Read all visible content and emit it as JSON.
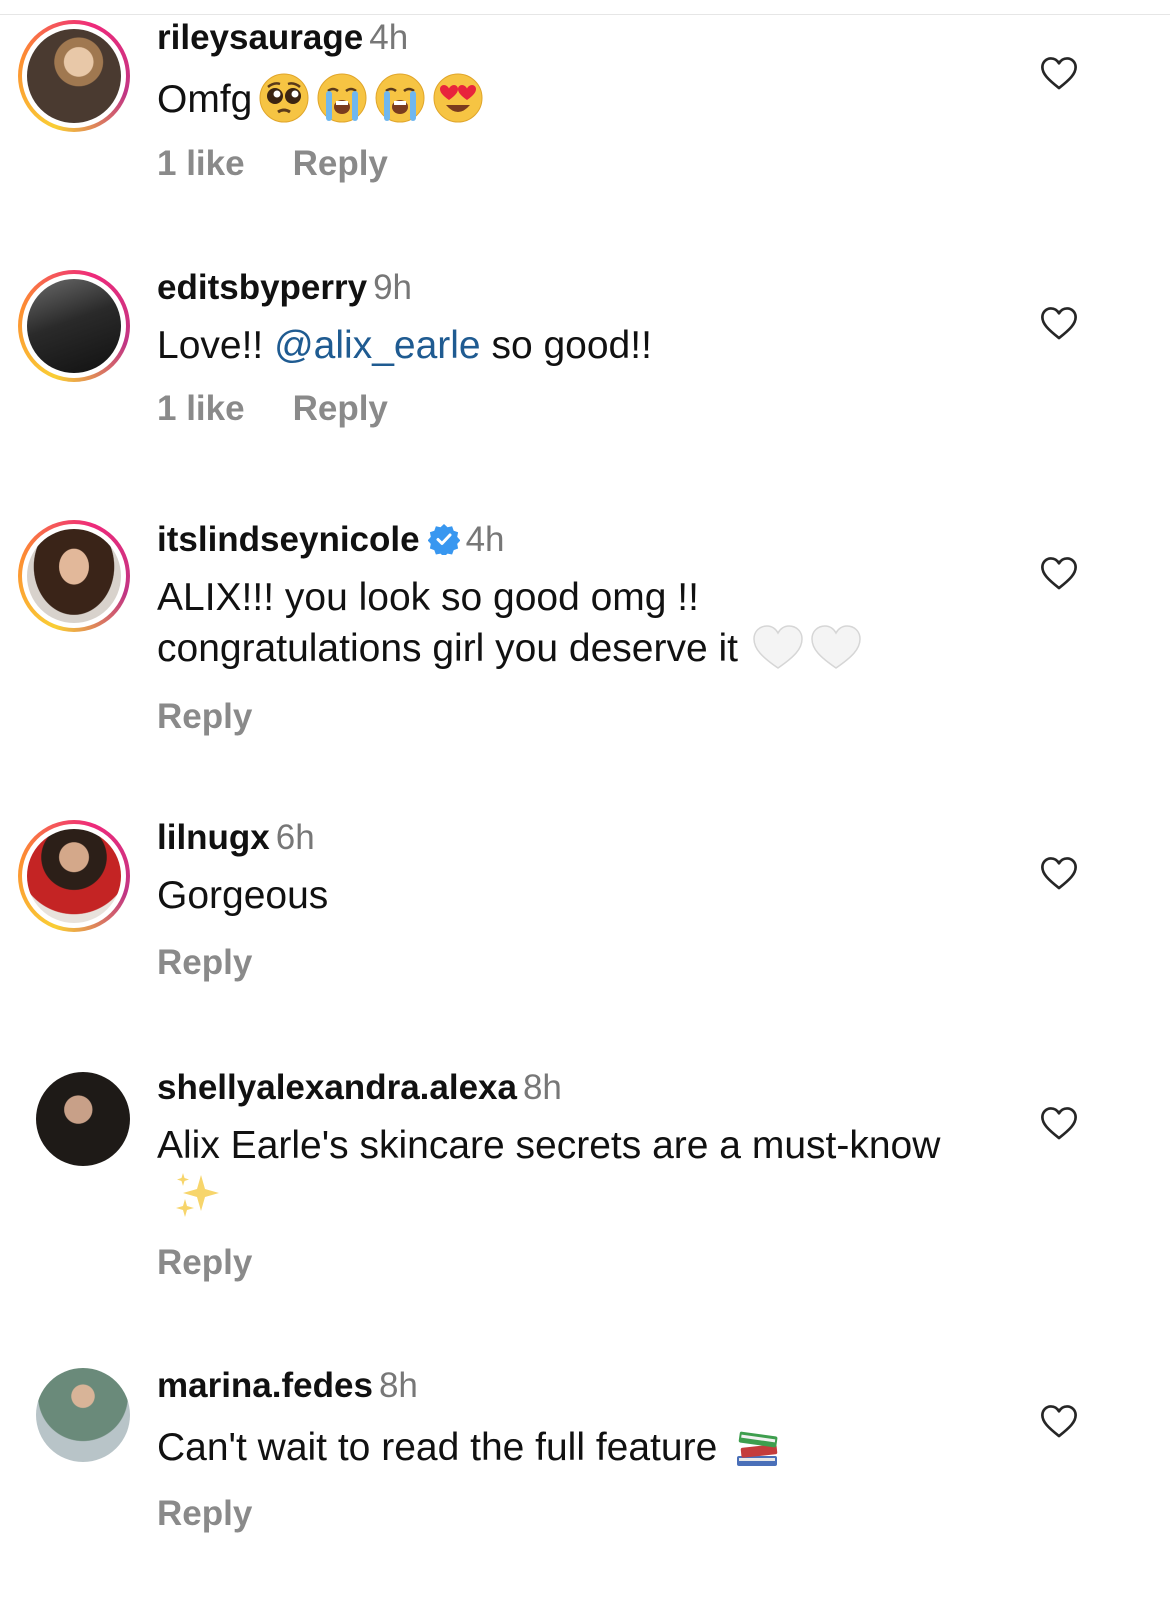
{
  "comments": [
    {
      "username": "rileysaurage",
      "time": "4h",
      "text": "Omfg",
      "emojis": [
        "pleading-face",
        "loudly-crying-face",
        "loudly-crying-face",
        "heart-eyes-face"
      ],
      "likes": "1 like",
      "reply": "Reply",
      "story_ring": true
    },
    {
      "username": "editsbyperry",
      "time": "9h",
      "text_before": "Love!! ",
      "mention": "@alix_earle",
      "text_after": " so good!!",
      "likes": "1 like",
      "reply": "Reply",
      "story_ring": true
    },
    {
      "username": "itslindseynicole",
      "verified": true,
      "time": "4h",
      "text": "ALIX!!! you look so good omg !! congratulations girl you deserve it",
      "emojis": [
        "white-heart",
        "white-heart"
      ],
      "reply": "Reply",
      "story_ring": true
    },
    {
      "username": "lilnugx",
      "time": "6h",
      "text": "Gorgeous",
      "reply": "Reply",
      "story_ring": true
    },
    {
      "username": "shellyalexandra.alexa",
      "time": "8h",
      "text": "Alix Earle's skincare secrets are a must-know",
      "emojis": [
        "sparkles"
      ],
      "reply": "Reply",
      "story_ring": false
    },
    {
      "username": "marina.fedes",
      "time": "8h",
      "text": "Can't wait to read the full feature",
      "emojis": [
        "books"
      ],
      "reply": "Reply",
      "story_ring": false
    }
  ],
  "colors": {
    "mention": "#1f5b91",
    "secondary_text": "#8a8a8a",
    "verified_badge": "#3897f0"
  },
  "icons": {
    "like": "heart-outline-icon",
    "verified": "verified-badge-icon"
  }
}
